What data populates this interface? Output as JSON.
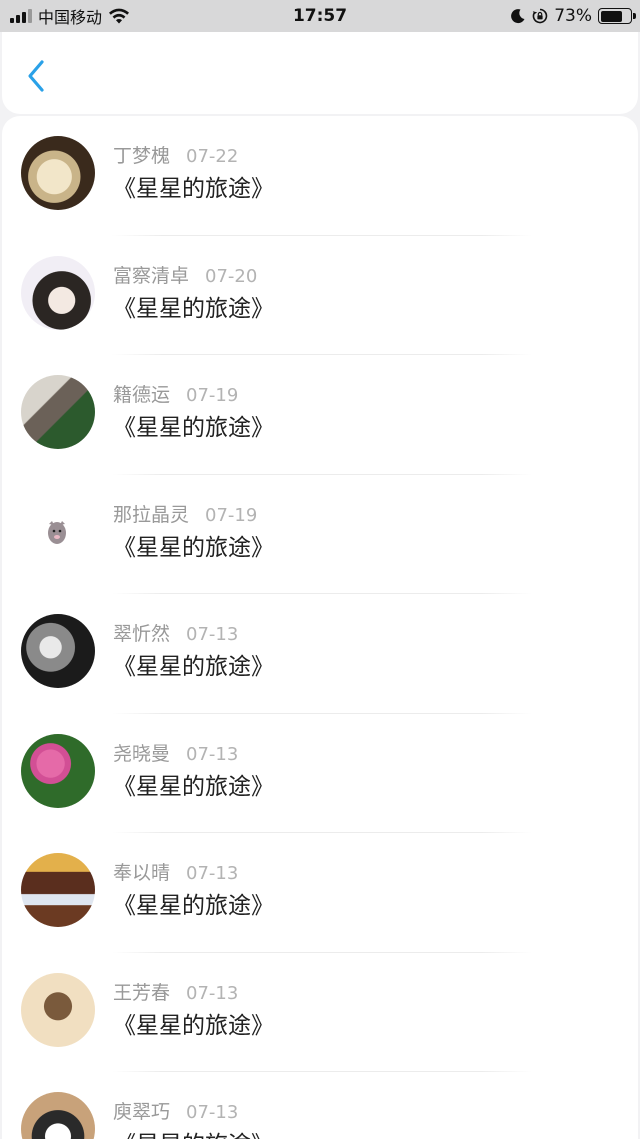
{
  "status_bar": {
    "carrier": "中国移动",
    "time": "17:57",
    "battery": "73%",
    "battery_level": 0.73,
    "icons": [
      "signal-icon",
      "wifi-icon",
      "moon-icon",
      "orientation-lock-icon",
      "battery-icon"
    ]
  },
  "header": {
    "back_icon": "chevron-left-icon",
    "accent_color": "#2aa1e8"
  },
  "list": {
    "items": [
      {
        "name": "丁梦槐",
        "date": "07-22",
        "title": "《星星的旅途》"
      },
      {
        "name": "富察清卓",
        "date": "07-20",
        "title": "《星星的旅途》"
      },
      {
        "name": "籍德运",
        "date": "07-19",
        "title": "《星星的旅途》"
      },
      {
        "name": "那拉晶灵",
        "date": "07-19",
        "title": "《星星的旅途》"
      },
      {
        "name": "翠忻然",
        "date": "07-13",
        "title": "《星星的旅途》"
      },
      {
        "name": "尧晓曼",
        "date": "07-13",
        "title": "《星星的旅途》"
      },
      {
        "name": "奉以晴",
        "date": "07-13",
        "title": "《星星的旅途》"
      },
      {
        "name": "王芳春",
        "date": "07-13",
        "title": "《星星的旅途》"
      },
      {
        "name": "庾翠巧",
        "date": "07-13",
        "title": "《星星的旅途》"
      }
    ]
  }
}
